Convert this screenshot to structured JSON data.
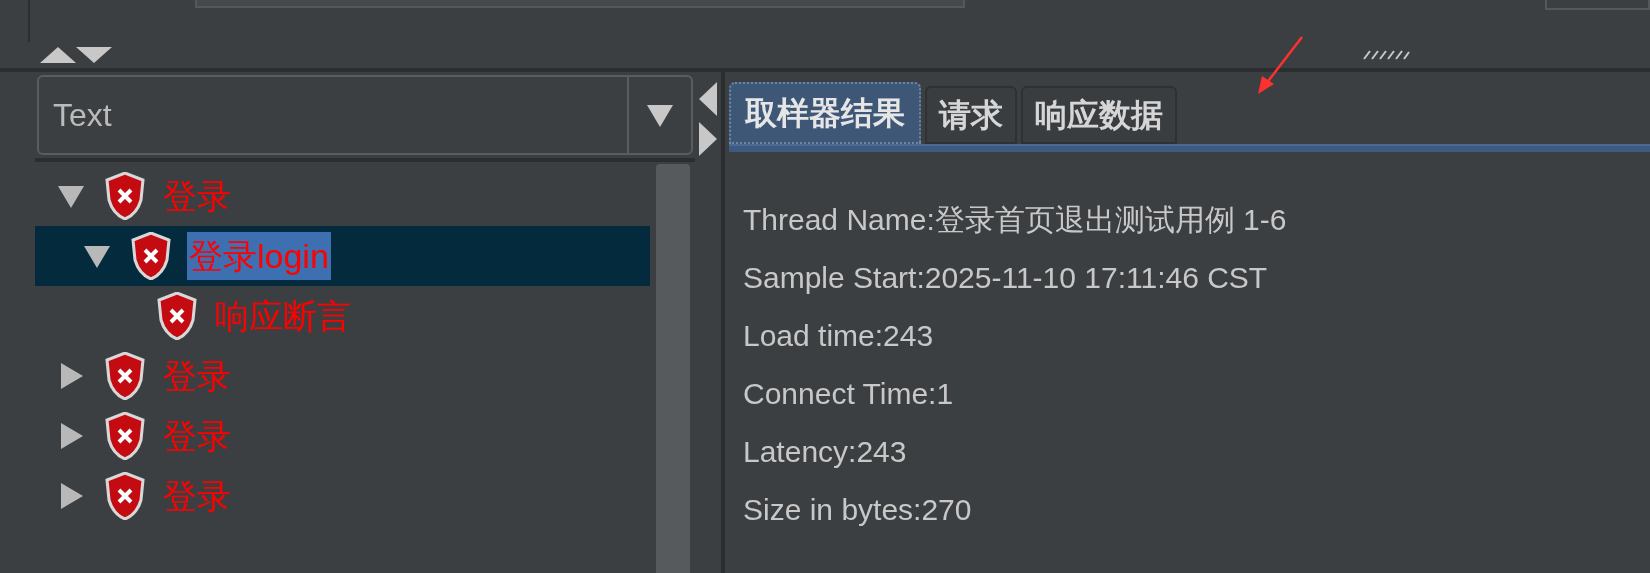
{
  "combo": {
    "value": "Text"
  },
  "tree": [
    {
      "label": "登录",
      "expanded": true,
      "selected": false,
      "children": [
        {
          "label": "登录login",
          "expanded": true,
          "selected": true,
          "children": [
            {
              "label": "响应断言",
              "selected": false
            }
          ]
        }
      ]
    },
    {
      "label": "登录",
      "expanded": false,
      "selected": false
    },
    {
      "label": "登录",
      "expanded": false,
      "selected": false
    },
    {
      "label": "登录",
      "expanded": false,
      "selected": false
    }
  ],
  "tabs": [
    {
      "label": "取样器结果",
      "selected": true
    },
    {
      "label": "请求",
      "selected": false
    },
    {
      "label": "响应数据",
      "selected": false
    }
  ],
  "sampler_result": [
    "Thread Name:登录首页退出测试用例 1-6",
    "Sample Start:2025-11-10 17:11:46 CST",
    "Load time:243",
    "Connect Time:1",
    "Latency:243",
    "Size in bytes:270"
  ]
}
